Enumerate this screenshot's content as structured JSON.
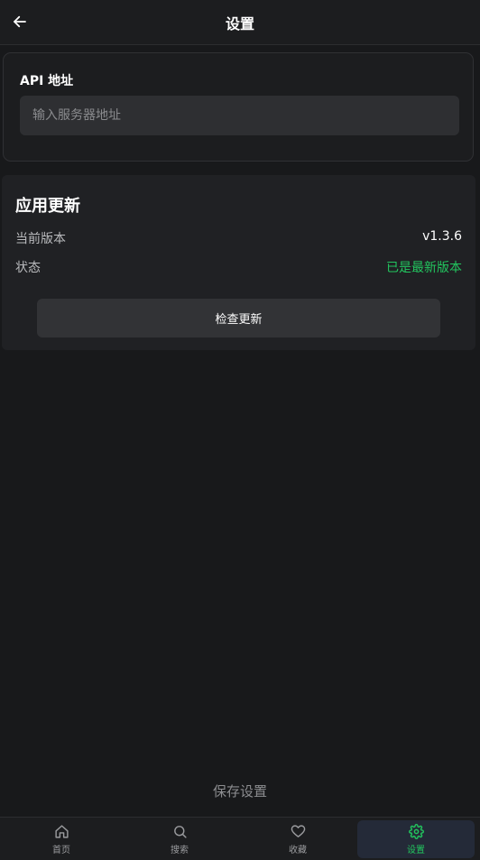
{
  "header": {
    "title": "设置"
  },
  "api": {
    "label": "API 地址",
    "value": "",
    "placeholder": "输入服务器地址"
  },
  "update": {
    "title": "应用更新",
    "rows": [
      {
        "key": "当前版本",
        "value": "v1.3.6"
      },
      {
        "key": "状态",
        "value": "已是最新版本"
      }
    ],
    "check_label": "检查更新"
  },
  "save_label": "保存设置",
  "nav": {
    "items": [
      {
        "label": "首页",
        "icon": "home-icon"
      },
      {
        "label": "搜索",
        "icon": "search-icon"
      },
      {
        "label": "收藏",
        "icon": "heart-icon"
      },
      {
        "label": "设置",
        "icon": "gear-icon",
        "active": true
      }
    ]
  },
  "colors": {
    "background": "#18191b",
    "accent": "#22c55e",
    "card": "#202124"
  }
}
